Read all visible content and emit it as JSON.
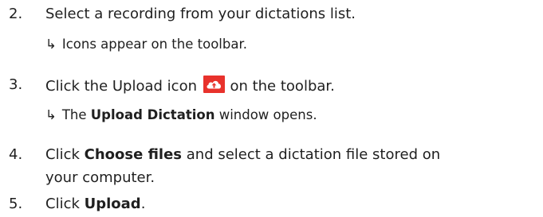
{
  "arrow_glyph": "↳",
  "icon_color": "#e8322c",
  "steps": [
    {
      "num": "2.",
      "text": "Select a recording from your dictations list.",
      "result": "Icons appear on the toolbar."
    },
    {
      "num": "3.",
      "text_before_icon": "Click the Upload icon",
      "icon": "upload-cloud-icon",
      "text_after_icon": "on the toolbar.",
      "result_pre": "The",
      "result_bold": "Upload Dictation",
      "result_post": "window opens."
    },
    {
      "num": "4.",
      "text_pre": "Click",
      "text_bold": "Choose files",
      "text_post": "and select a dictation file stored on",
      "text_line2": "your computer."
    },
    {
      "num": "5.",
      "text_pre": "Click",
      "text_bold": "Upload",
      "text_post": "."
    }
  ]
}
